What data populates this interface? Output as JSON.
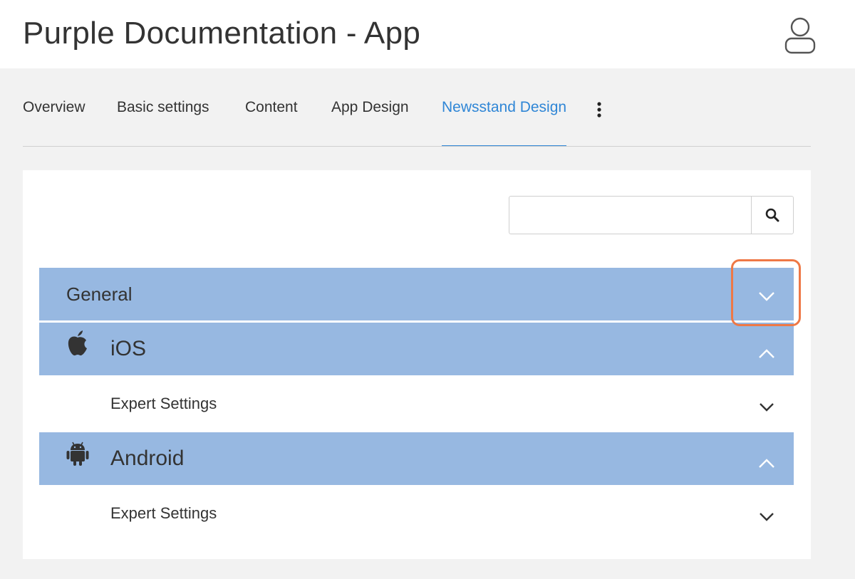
{
  "header": {
    "title": "Purple Documentation - App",
    "user_icon": "user-icon"
  },
  "tabs": [
    {
      "label": "Overview",
      "active": false
    },
    {
      "label": "Basic settings",
      "active": false
    },
    {
      "label": "Content",
      "active": false
    },
    {
      "label": "App Design",
      "active": false
    },
    {
      "label": "Newsstand Design",
      "active": true
    }
  ],
  "more_menu_icon": "vertical-ellipsis-icon",
  "search": {
    "value": "",
    "placeholder": "",
    "icon": "search-icon"
  },
  "sections": [
    {
      "label": "General",
      "icon": null,
      "chevron": "chevron-down",
      "highlighted": true
    },
    {
      "label": "iOS",
      "icon": "apple-icon",
      "chevron": "chevron-up",
      "subsections": [
        {
          "label": "Expert Settings",
          "chevron": "chevron-down"
        }
      ]
    },
    {
      "label": "Android",
      "icon": "android-icon",
      "chevron": "chevron-up",
      "subsections": [
        {
          "label": "Expert Settings",
          "chevron": "chevron-down"
        }
      ]
    }
  ],
  "colors": {
    "accent": "#2f86d6",
    "section_bg": "#97b8e1",
    "highlight": "#ee7846",
    "page_bg": "#f2f2f2"
  }
}
